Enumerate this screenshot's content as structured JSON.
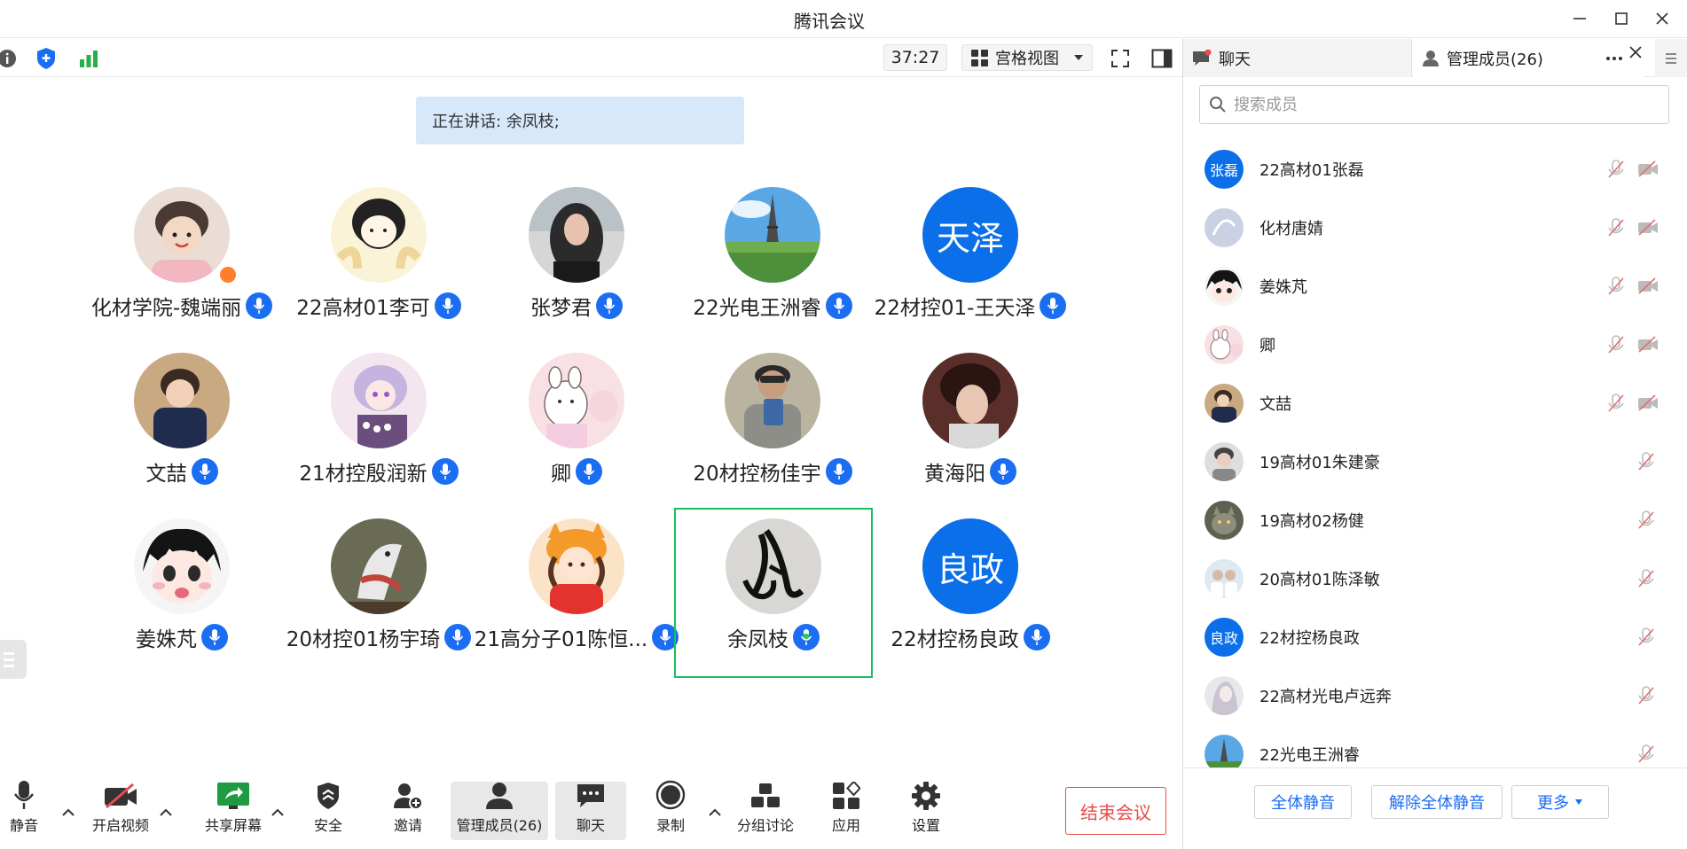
{
  "window": {
    "title": "腾讯会议"
  },
  "topbar": {
    "timer": "37:27",
    "view_mode": "宫格视图"
  },
  "speaking": {
    "text": "正在讲话: 余凤枝;"
  },
  "tiles": [
    {
      "name": "化材学院-魏端丽",
      "avatar": "photo"
    },
    {
      "name": "22高材01李可",
      "avatar": "cartoon"
    },
    {
      "name": "张梦君",
      "avatar": "photo"
    },
    {
      "name": "22光电王洲睿",
      "avatar": "photo"
    },
    {
      "name": "22材控01-王天泽",
      "avatar_text": "天泽"
    },
    {
      "name": "文喆",
      "avatar": "photo"
    },
    {
      "name": "21材控殷润新",
      "avatar": "cartoon"
    },
    {
      "name": "卿",
      "avatar": "cartoon"
    },
    {
      "name": "20材控杨佳宇",
      "avatar": "photo"
    },
    {
      "name": "黄海阳",
      "avatar": "cartoon"
    },
    {
      "name": "姜姝芃",
      "avatar": "cartoon"
    },
    {
      "name": "20材控01杨宇琦",
      "avatar": "cartoon"
    },
    {
      "name": "21高分子01陈恒...",
      "avatar": "cartoon"
    },
    {
      "name": "余凤枝",
      "avatar": "calligraphy"
    },
    {
      "name": "22材控杨良政",
      "avatar_text": "良政"
    }
  ],
  "bottombar": {
    "mute": "静音",
    "video": "开启视频",
    "share": "共享屏幕",
    "security": "安全",
    "invite": "邀请",
    "members": "管理成员(26)",
    "chat": "聊天",
    "record": "录制",
    "breakout": "分组讨论",
    "apps": "应用",
    "settings": "设置",
    "end": "结束会议"
  },
  "panel": {
    "tab_chat": "聊天",
    "tab_members": "管理成员(26)",
    "search_placeholder": "搜索成员",
    "members": [
      {
        "name": "22高材01张磊",
        "avatar_text": "张磊"
      },
      {
        "name": "化材唐婧"
      },
      {
        "name": "姜姝芃"
      },
      {
        "name": "卿"
      },
      {
        "name": "文喆"
      },
      {
        "name": "19高材01朱建豪"
      },
      {
        "name": "19高材02杨健"
      },
      {
        "name": "20高材01陈泽敏"
      },
      {
        "name": "22材控杨良政",
        "avatar_text": "良政"
      },
      {
        "name": "22高材光电卢远奔"
      },
      {
        "name": "22光电王洲睿"
      }
    ],
    "mute_all": "全体静音",
    "unmute_all": "解除全体静音",
    "more": "更多"
  },
  "colors": {
    "accent": "#1b6df2",
    "avatar_blue": "#0a6fe8",
    "active_speaker": "#17c05e",
    "end_red": "#e84c4c",
    "banner": "#d8e8fb"
  }
}
